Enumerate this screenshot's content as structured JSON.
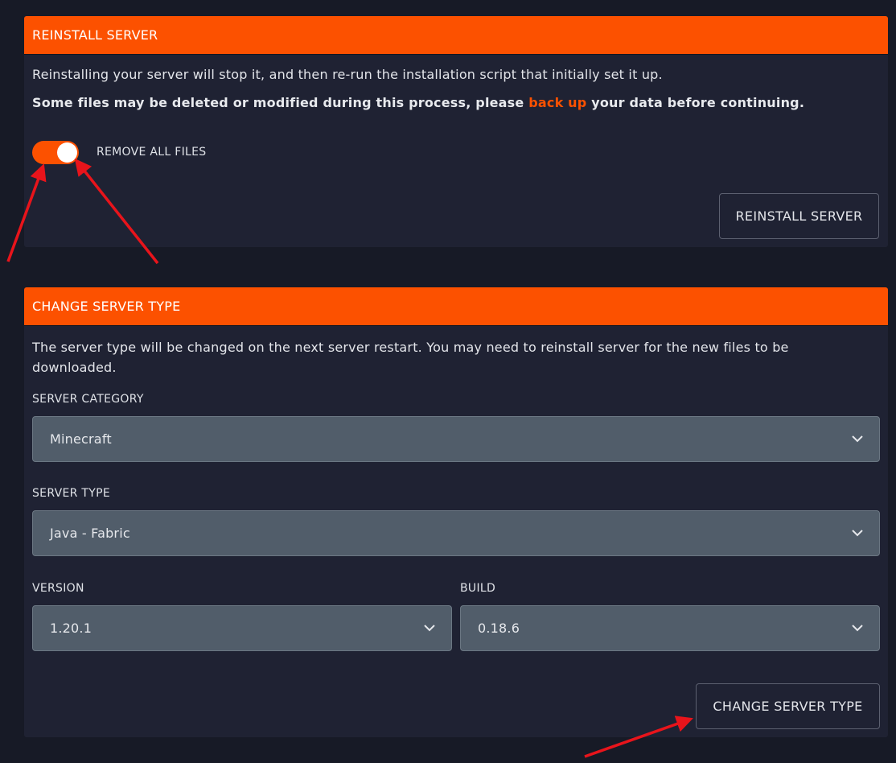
{
  "reinstall": {
    "header": "REINSTALL SERVER",
    "description": "Reinstalling your server will stop it, and then re-run the installation script that initially set it up.",
    "warning_prefix": "Some files may be deleted or modified during this process, please ",
    "warning_link": "back up",
    "warning_suffix": " your data before continuing.",
    "toggle_label": "REMOVE ALL FILES",
    "toggle_on": true,
    "button_label": "REINSTALL SERVER"
  },
  "change_type": {
    "header": "CHANGE SERVER TYPE",
    "description": "The server type will be changed on the next server restart. You may need to reinstall server for the new files to be downloaded.",
    "category_label": "SERVER CATEGORY",
    "category_value": "Minecraft",
    "type_label": "SERVER TYPE",
    "type_value": "Java - Fabric",
    "version_label": "VERSION",
    "version_value": "1.20.1",
    "build_label": "BUILD",
    "build_value": "0.18.6",
    "button_label": "CHANGE SERVER TYPE"
  },
  "colors": {
    "accent": "#fc5100",
    "background": "#171a26",
    "panel": "#1f2233",
    "select": "#515d6a",
    "annotation_arrow": "#e8141b"
  },
  "icons": {
    "select_chevron": "chevron-down-icon",
    "annotation": "red-arrow-annotation"
  }
}
